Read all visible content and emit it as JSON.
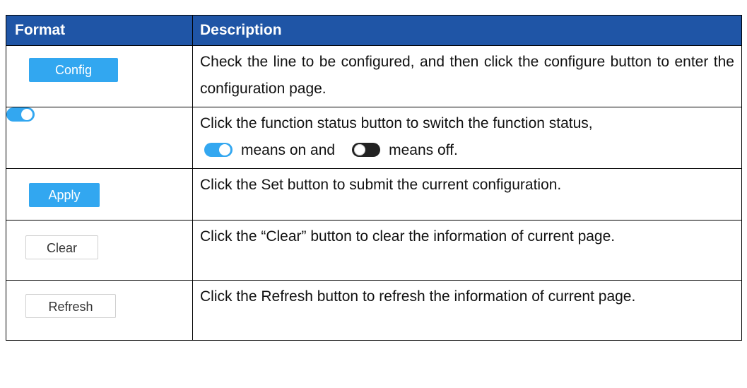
{
  "table": {
    "headers": {
      "format": "Format",
      "description": "Description"
    },
    "rows": [
      {
        "format_label": "Config",
        "description": "Check the line to be configured, and then click the configure button to enter the configuration page."
      },
      {
        "format_label": "",
        "description_line1": "Click the function status button to switch the function status,",
        "description_mid": "means on and",
        "description_end": "means off."
      },
      {
        "format_label": "Apply",
        "description": "Click the Set button to submit the current configuration."
      },
      {
        "format_label": "Clear",
        "description": "Click the “Clear” button to clear the information of current page."
      },
      {
        "format_label": "Refresh",
        "description": "Click the Refresh button to refresh the information of current page."
      }
    ]
  },
  "colors": {
    "header_bg": "#1f55a6",
    "header_text": "#ffffff",
    "button_blue": "#32a7f0",
    "toggle_on": "#33a7f0",
    "toggle_off": "#222222"
  },
  "icons": {
    "toggle_on": "toggle-on-icon",
    "toggle_off": "toggle-off-icon"
  }
}
